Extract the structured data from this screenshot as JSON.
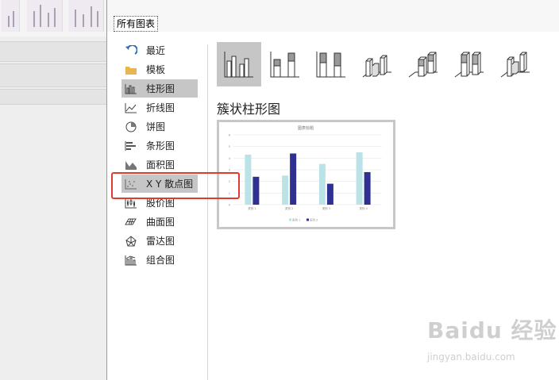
{
  "dialog": {
    "tab_label": "所有图表",
    "categories": [
      {
        "label": "最近",
        "icon": "recent-icon"
      },
      {
        "label": "模板",
        "icon": "folder-icon"
      },
      {
        "label": "柱形图",
        "icon": "column-chart-icon",
        "selected": true
      },
      {
        "label": "折线图",
        "icon": "line-chart-icon"
      },
      {
        "label": "饼图",
        "icon": "pie-chart-icon"
      },
      {
        "label": "条形图",
        "icon": "bar-chart-icon"
      },
      {
        "label": "面积图",
        "icon": "area-chart-icon"
      },
      {
        "label": "X Y 散点图",
        "icon": "scatter-chart-icon",
        "highlighted": true
      },
      {
        "label": "股价图",
        "icon": "stock-chart-icon"
      },
      {
        "label": "曲面图",
        "icon": "surface-chart-icon"
      },
      {
        "label": "雷达图",
        "icon": "radar-chart-icon"
      },
      {
        "label": "组合图",
        "icon": "combo-chart-icon"
      }
    ],
    "subtypes": [
      {
        "name": "clustered-column",
        "icon": "clustered-column-icon",
        "selected": true
      },
      {
        "name": "stacked-column",
        "icon": "stacked-column-icon"
      },
      {
        "name": "100-stacked-column",
        "icon": "percent-stacked-column-icon"
      },
      {
        "name": "3d-clustered-column",
        "icon": "3d-clustered-column-icon"
      },
      {
        "name": "3d-stacked-column",
        "icon": "3d-stacked-column-icon"
      },
      {
        "name": "3d-100-stacked-column",
        "icon": "3d-percent-stacked-column-icon"
      },
      {
        "name": "3d-column",
        "icon": "3d-column-icon"
      }
    ],
    "subtype_title": "簇状柱形图"
  },
  "watermark": {
    "logo": "Baidu 经验",
    "url": "jingyan.baidu.com"
  },
  "colors": {
    "series1": "#b9e3e6",
    "series2": "#2e3192",
    "highlight": "#e23a2f",
    "selected_bg": "#c6c6c6"
  },
  "chart_data": {
    "type": "bar",
    "title": "图表标题",
    "categories": [
      "类别 1",
      "类别 2",
      "类别 3",
      "类别 4"
    ],
    "series": [
      {
        "name": "系列 1",
        "values": [
          4.3,
          2.5,
          3.5,
          4.5
        ]
      },
      {
        "name": "系列 2",
        "values": [
          2.4,
          4.4,
          1.8,
          2.8
        ]
      }
    ],
    "ylim": [
      0,
      6
    ],
    "yticks": [
      "0",
      "1",
      "2",
      "3",
      "4",
      "5",
      "6"
    ],
    "legend": "bottom",
    "grid": true
  }
}
